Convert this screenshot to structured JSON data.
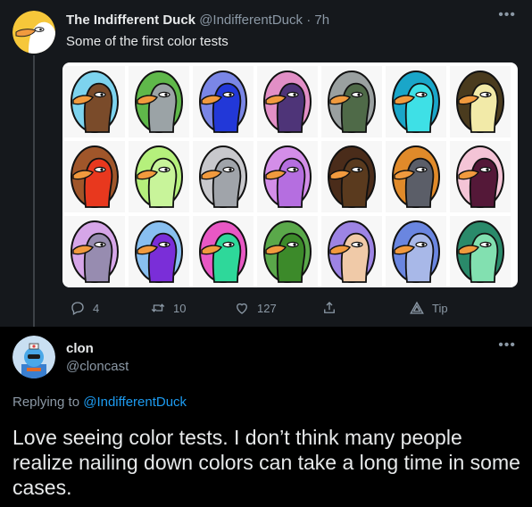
{
  "tweet": {
    "author_name": "The Indifferent Duck",
    "author_handle": "@IndifferentDuck",
    "separator": "·",
    "time": "7h",
    "text": "Some of the first color tests",
    "more_icon": "more-icon",
    "media": {
      "tiles": [
        {
          "bg": "#7dd3ee",
          "body": "#7a4b2a"
        },
        {
          "bg": "#5fb84a",
          "body": "#9ba3a6"
        },
        {
          "bg": "#7a86e6",
          "body": "#2238d8"
        },
        {
          "bg": "#e28fc6",
          "body": "#4e3478"
        },
        {
          "bg": "#9aa0a0",
          "body": "#4f6a48"
        },
        {
          "bg": "#1aa6c9",
          "body": "#3ee0e6"
        },
        {
          "bg": "#4a3b1e",
          "body": "#f2eaa8"
        },
        {
          "bg": "#a0562a",
          "body": "#e8381e"
        },
        {
          "bg": "#b5f07c",
          "body": "#c8f49a"
        },
        {
          "bg": "#c8c8cc",
          "body": "#a0a4aa"
        },
        {
          "bg": "#d38ee8",
          "body": "#b56ee0"
        },
        {
          "bg": "#4a2c1a",
          "body": "#5a3a1e"
        },
        {
          "bg": "#e08a2a",
          "body": "#5b5e68"
        },
        {
          "bg": "#f4c4d6",
          "body": "#541838"
        },
        {
          "bg": "#d6a6e8",
          "body": "#978cb0"
        },
        {
          "bg": "#88bff0",
          "body": "#7a2ed8"
        },
        {
          "bg": "#e858c4",
          "body": "#2ed89a"
        },
        {
          "bg": "#5aa84a",
          "body": "#3c8a2a"
        },
        {
          "bg": "#9d84e4",
          "body": "#f0caa8"
        },
        {
          "bg": "#6a86e0",
          "body": "#a8b8e8"
        },
        {
          "bg": "#2a8a6a",
          "body": "#82e0b0"
        }
      ]
    },
    "actions": {
      "reply_icon": "reply-icon",
      "reply_count": "4",
      "retweet_icon": "retweet-icon",
      "retweet_count": "10",
      "like_icon": "like-icon",
      "like_count": "127",
      "share_icon": "share-icon",
      "tip_icon": "tip-icon",
      "tip_label": "Tip"
    }
  },
  "reply": {
    "author_name": "clon",
    "author_handle": "@cloncast",
    "more_icon": "more-icon",
    "replying_prefix": "Replying to",
    "replying_to": "@IndifferentDuck",
    "text": "Love seeing color tests. I don’t think many people realize nailing down colors can take a long time in some cases."
  },
  "colors": {
    "background_top": "#15181c",
    "background_bottom": "#000000",
    "link": "#1d9bf0",
    "secondary_text": "#8b98a5"
  }
}
